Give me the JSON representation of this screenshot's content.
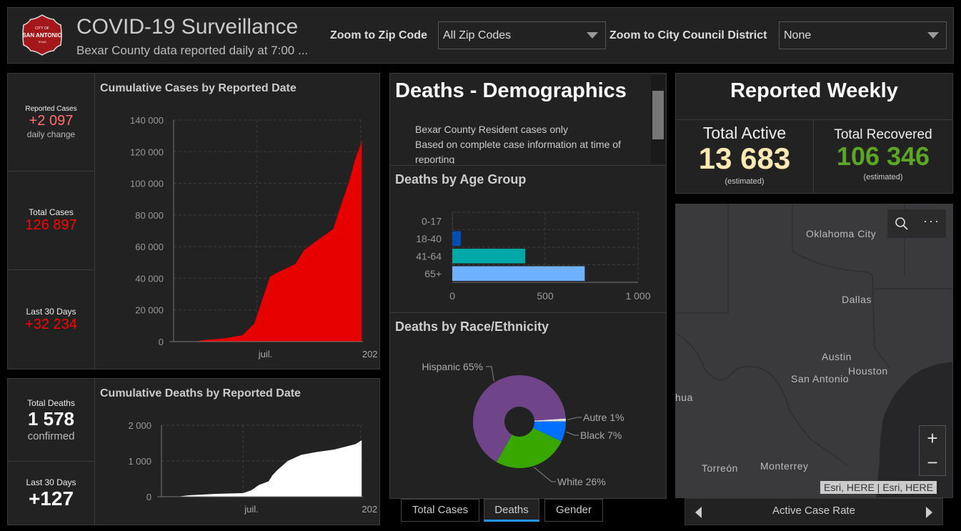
{
  "header": {
    "title": "COVID-19 Surveillance",
    "subtitle": "Bexar County data reported daily at 7:00 ...",
    "logo_text": "CITY OF SAN ANTONIO TEXAS",
    "zip_label": "Zoom to Zip Code",
    "zip_value": "All Zip Codes",
    "district_label": "Zoom to City Council District",
    "district_value": "None"
  },
  "cases": {
    "reported_label": "Reported Cases",
    "reported_value": "+2 097",
    "reported_sub": "daily change",
    "total_label": "Total Cases",
    "total_value": "126 897",
    "last30_label": "Last 30 Days",
    "last30_value": "+32 234"
  },
  "deaths": {
    "total_label": "Total Deaths",
    "total_value": "1 578",
    "total_sub": "confirmed",
    "last30_label": "Last 30 Days",
    "last30_value": "+127"
  },
  "demographics": {
    "title": "Deaths - Demographics",
    "bullets": [
      "Bexar County Resident cases only",
      "Based on complete case information at time of reporting"
    ]
  },
  "weekly": {
    "title": "Reported Weekly",
    "active_label": "Total Active",
    "active_value": "13 683",
    "active_sub": "(estimated)",
    "recovered_label": "Total Recovered",
    "recovered_value": "106 346",
    "recovered_sub": "(estimated)"
  },
  "map": {
    "labels": [
      "Oklahoma City",
      "Dallas",
      "Austin",
      "San Antonio",
      "Houston",
      "hua",
      "Torreón",
      "Monterrey"
    ],
    "attribution": "Esri, HERE | Esri, HERE",
    "zoom_in": "+",
    "zoom_out": "−",
    "nav_label": "Active Case Rate"
  },
  "tabs": [
    {
      "label": "Total Cases",
      "active": false
    },
    {
      "label": "Deaths",
      "active": true
    },
    {
      "label": "Gender",
      "active": false
    }
  ],
  "colors": {
    "cases": "#e60000",
    "deaths": "#ffffff",
    "accent": "#2196f3",
    "recovered": "#5da625",
    "active": "#ffe9b3"
  },
  "chart_data": [
    {
      "type": "area",
      "title": "Cumulative Cases by Reported Date",
      "x_ticks": [
        "juil.",
        "202"
      ],
      "y_ticks": [
        "0",
        "20 000",
        "40 000",
        "60 000",
        "80 000",
        "100 000",
        "120 000",
        "140 000"
      ],
      "ylim": [
        0,
        140000
      ],
      "xlim": [
        "2020-02-04",
        "2021-01-05"
      ],
      "grid": true,
      "x": [
        "2020-03-12",
        "2020-03-29",
        "2020-05-02",
        "2020-06-05",
        "2020-06-26",
        "2020-07-09",
        "2020-07-24",
        "2020-08-08",
        "2020-09-07",
        "2020-09-23",
        "2020-10-12",
        "2020-11-13",
        "2020-11-26",
        "2020-12-13",
        "2020-12-22",
        "2021-01-03"
      ],
      "y": [
        0,
        1000,
        2000,
        4000,
        11300,
        25000,
        41000,
        44000,
        49000,
        58000,
        63000,
        71000,
        85000,
        103000,
        115000,
        126897
      ]
    },
    {
      "type": "area",
      "title": "Cumulative Deaths by Reported Date",
      "x_ticks": [
        "juil.",
        "202"
      ],
      "y_ticks": [
        "0",
        "1 000",
        "2 000"
      ],
      "ylim": [
        0,
        2000
      ],
      "xlim": [
        "2020-02-24",
        "2021-01-05"
      ],
      "grid": true,
      "x": [
        "2020-03-20",
        "2020-04-07",
        "2020-05-20",
        "2020-07-01",
        "2020-07-14",
        "2020-07-26",
        "2020-08-10",
        "2020-08-16",
        "2020-08-24",
        "2020-09-09",
        "2020-09-30",
        "2020-10-24",
        "2020-11-21",
        "2020-12-24",
        "2021-01-03"
      ],
      "y": [
        0,
        40,
        80,
        100,
        180,
        330,
        430,
        600,
        750,
        1000,
        1170,
        1250,
        1320,
        1470,
        1578
      ]
    },
    {
      "type": "bar",
      "orientation": "horizontal",
      "title": "Deaths by Age Group",
      "categories": [
        "0-17",
        "18-40",
        "41-64",
        "65+"
      ],
      "values": [
        3,
        46,
        392,
        713
      ],
      "colors": [
        "#0d47a1",
        "#0050b3",
        "#00a8a8",
        "#6eb1ff"
      ],
      "x_ticks": [
        "0",
        "500",
        "1 000"
      ],
      "xlim": [
        0,
        1000
      ],
      "grid": true
    },
    {
      "type": "pie",
      "donut": true,
      "title": "Deaths by Race/Ethnicity",
      "slices": [
        {
          "label": "Autre 1%",
          "value": 1,
          "color": "#e0e0e0"
        },
        {
          "label": "Black 7%",
          "value": 7,
          "color": "#0070ff"
        },
        {
          "label": "White 26%",
          "value": 26,
          "color": "#38a800"
        },
        {
          "label": "Hispanic 65%",
          "value": 65,
          "color": "#704489"
        }
      ]
    }
  ]
}
